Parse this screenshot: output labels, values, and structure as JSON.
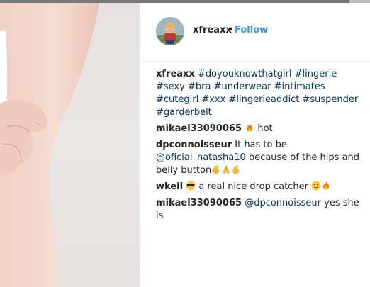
{
  "post": {
    "username": "xfreaxx",
    "separator": "•",
    "follow_label": "Follow"
  },
  "caption": {
    "username": "xfreaxx",
    "hashtags": [
      "#doyouknowthatgirl",
      "#lingerie",
      "#sexy",
      "#bra",
      "#underwear",
      "#intimates",
      "#cutegirl",
      "#xxx",
      "#lingerieaddict",
      "#suspender",
      "#garderbelt"
    ]
  },
  "comments": [
    {
      "username": "mikael33090065",
      "emoji_before": "fire-emoji",
      "text": "hot"
    },
    {
      "username": "dpconnoisseur",
      "text_1": "It has to be",
      "mention": "@oficial_natasha10",
      "text_2": "because of the hips and belly button"
    },
    {
      "username": "wkeil",
      "emoji_before": "sunglasses-emoji",
      "text": "a real nice drop catcher"
    },
    {
      "username": "mikael33090065",
      "mention": "@dpconnoisseur",
      "text": "yes she is"
    }
  ],
  "colors": {
    "link": "#003569",
    "follow": "#3897f0",
    "text": "#262626"
  }
}
